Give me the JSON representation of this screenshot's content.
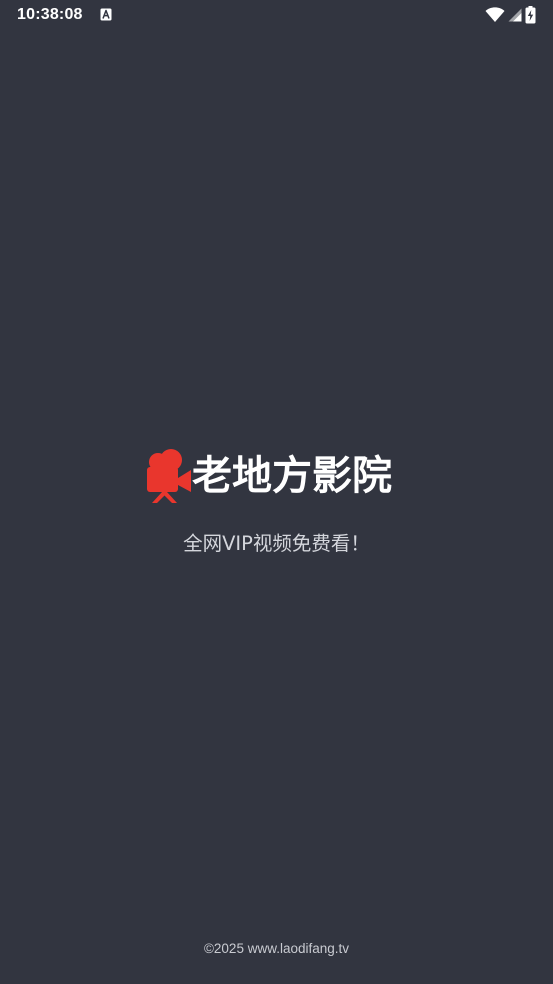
{
  "status_bar": {
    "time": "10:38:08",
    "notification_icon": "accessibility-a-icon",
    "icons": [
      "wifi-icon",
      "cell-signal-icon",
      "battery-charging-icon"
    ]
  },
  "splash": {
    "logo_icon": "movie-camera-icon",
    "app_name": "老地方影院",
    "tagline": "全网VIP视频免费看！"
  },
  "footer": {
    "copyright": "©2025 www.laodifang.tv"
  },
  "colors": {
    "background": "#323540",
    "brand_red": "#e9362d",
    "text_primary": "#ffffff",
    "text_secondary": "#d4d6dc"
  }
}
